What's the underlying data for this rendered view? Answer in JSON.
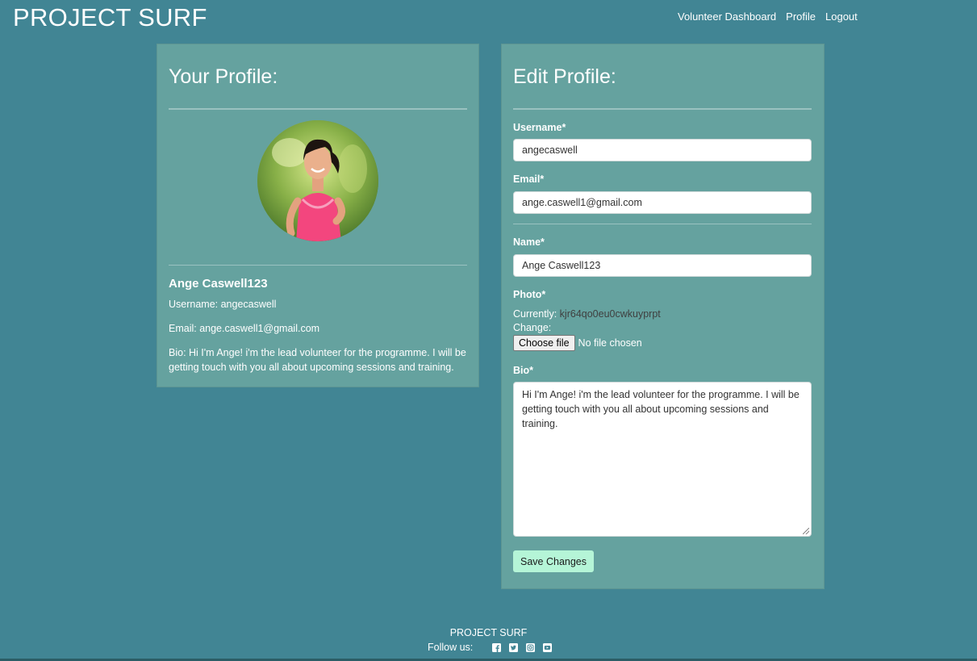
{
  "header": {
    "brand": "PROJECT SURF",
    "nav": [
      "Volunteer Dashboard",
      "Profile",
      "Logout"
    ]
  },
  "profile_card": {
    "title": "Your Profile:",
    "name": "Ange Caswell123",
    "username_line": "Username: angecaswell",
    "email_line": "Email: ange.caswell1@gmail.com",
    "bio_line": "Bio: Hi I'm Ange! i'm the lead volunteer for the programme. I will be getting touch with you all about upcoming sessions and training.",
    "avatar_icon": "avatar"
  },
  "edit_card": {
    "title": "Edit Profile:",
    "username_label": "Username*",
    "username_value": "angecaswell",
    "email_label": "Email*",
    "email_value": "ange.caswell1@gmail.com",
    "name_label": "Name*",
    "name_value": "Ange Caswell123",
    "photo_label": "Photo*",
    "currently_label": "Currently:",
    "currently_value": "kjr64qo0eu0cwkuyprpt",
    "change_label": "Change:",
    "choose_file": "Choose file",
    "no_file": "No file chosen",
    "bio_label": "Bio*",
    "bio_value": "Hi I'm Ange! i'm the lead volunteer for the programme. I will be getting touch with you all about upcoming sessions and training.",
    "save_label": "Save Changes"
  },
  "footer": {
    "title": "PROJECT SURF",
    "follow_label": "Follow us:",
    "icons": [
      "facebook-icon",
      "twitter-icon",
      "instagram-icon",
      "youtube-icon"
    ]
  },
  "colors": {
    "background": "#418594",
    "card": "#65a29f",
    "save_button": "#b5f5d7"
  }
}
